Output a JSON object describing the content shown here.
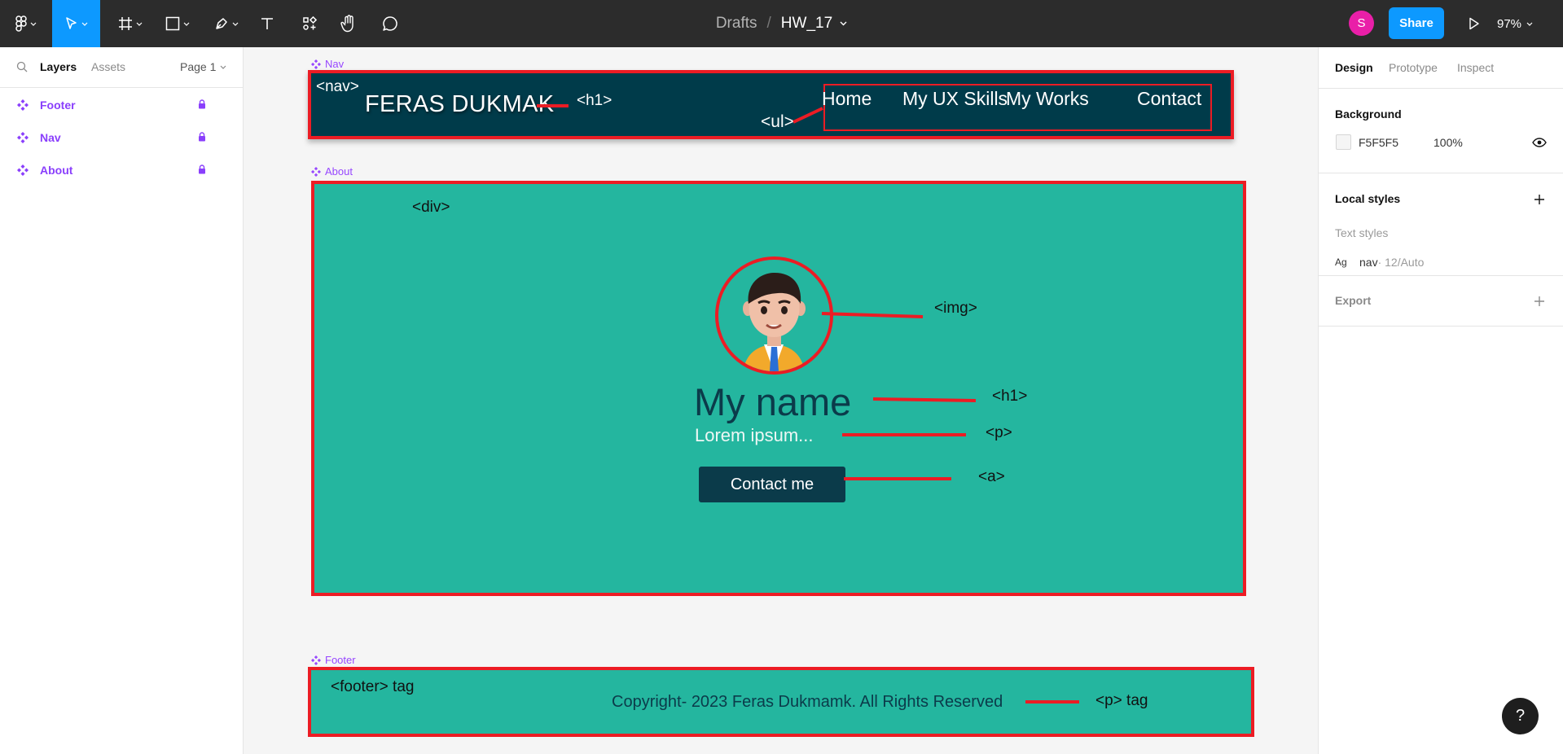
{
  "toolbar": {
    "breadcrumb_parent": "Drafts",
    "breadcrumb_separator": "/",
    "file_name": "HW_17",
    "user_initial": "S",
    "share_label": "Share",
    "zoom_level": "97%",
    "icons": [
      "figma-menu-icon",
      "move-tool-icon",
      "frame-tool-icon",
      "rectangle-tool-icon",
      "pen-tool-icon",
      "text-tool-icon",
      "components-icon",
      "hand-tool-icon",
      "comment-icon",
      "present-icon"
    ]
  },
  "left_panel": {
    "tabs": [
      "Layers",
      "Assets"
    ],
    "page_selector": "Page 1",
    "layers": [
      {
        "name": "Footer"
      },
      {
        "name": "Nav"
      },
      {
        "name": "About"
      }
    ]
  },
  "canvas": {
    "nav_frame": {
      "label": "Nav",
      "tag": "<nav>",
      "title": "FERAS DUKMAK",
      "title_tag": "<h1>",
      "list_tag": "<ul>",
      "links": [
        "Home",
        "My UX Skills",
        "My Works",
        "Contact"
      ]
    },
    "about_frame": {
      "label": "About",
      "div_tag": "<div>",
      "img_tag": "<img>",
      "name": "My name",
      "name_tag": "<h1>",
      "text": "Lorem ipsum...",
      "text_tag": "<p>",
      "button": "Contact me",
      "button_tag": "<a>"
    },
    "footer_frame": {
      "label": "Footer",
      "footer_tag": "<footer> tag",
      "copyright": "Copyright- 2023 Feras Dukmamk. All Rights Reserved",
      "p_tag": "<p> tag"
    }
  },
  "right_panel": {
    "tabs": [
      "Design",
      "Prototype",
      "Inspect"
    ],
    "background_heading": "Background",
    "background_color": "F5F5F5",
    "background_opacity": "100%",
    "local_styles_heading": "Local styles",
    "text_styles_heading": "Text styles",
    "style_prefix": "Ag",
    "style_name": "nav",
    "style_meta": " · 12/Auto",
    "export_heading": "Export"
  },
  "help_label": "?",
  "colors": {
    "toolbar_bg": "#2c2c2c",
    "accent": "#0d99ff",
    "component": "#9747ff",
    "nav_bg": "#003b4a",
    "about_bg": "#24b69f",
    "annotation_red": "#ec1c24"
  }
}
